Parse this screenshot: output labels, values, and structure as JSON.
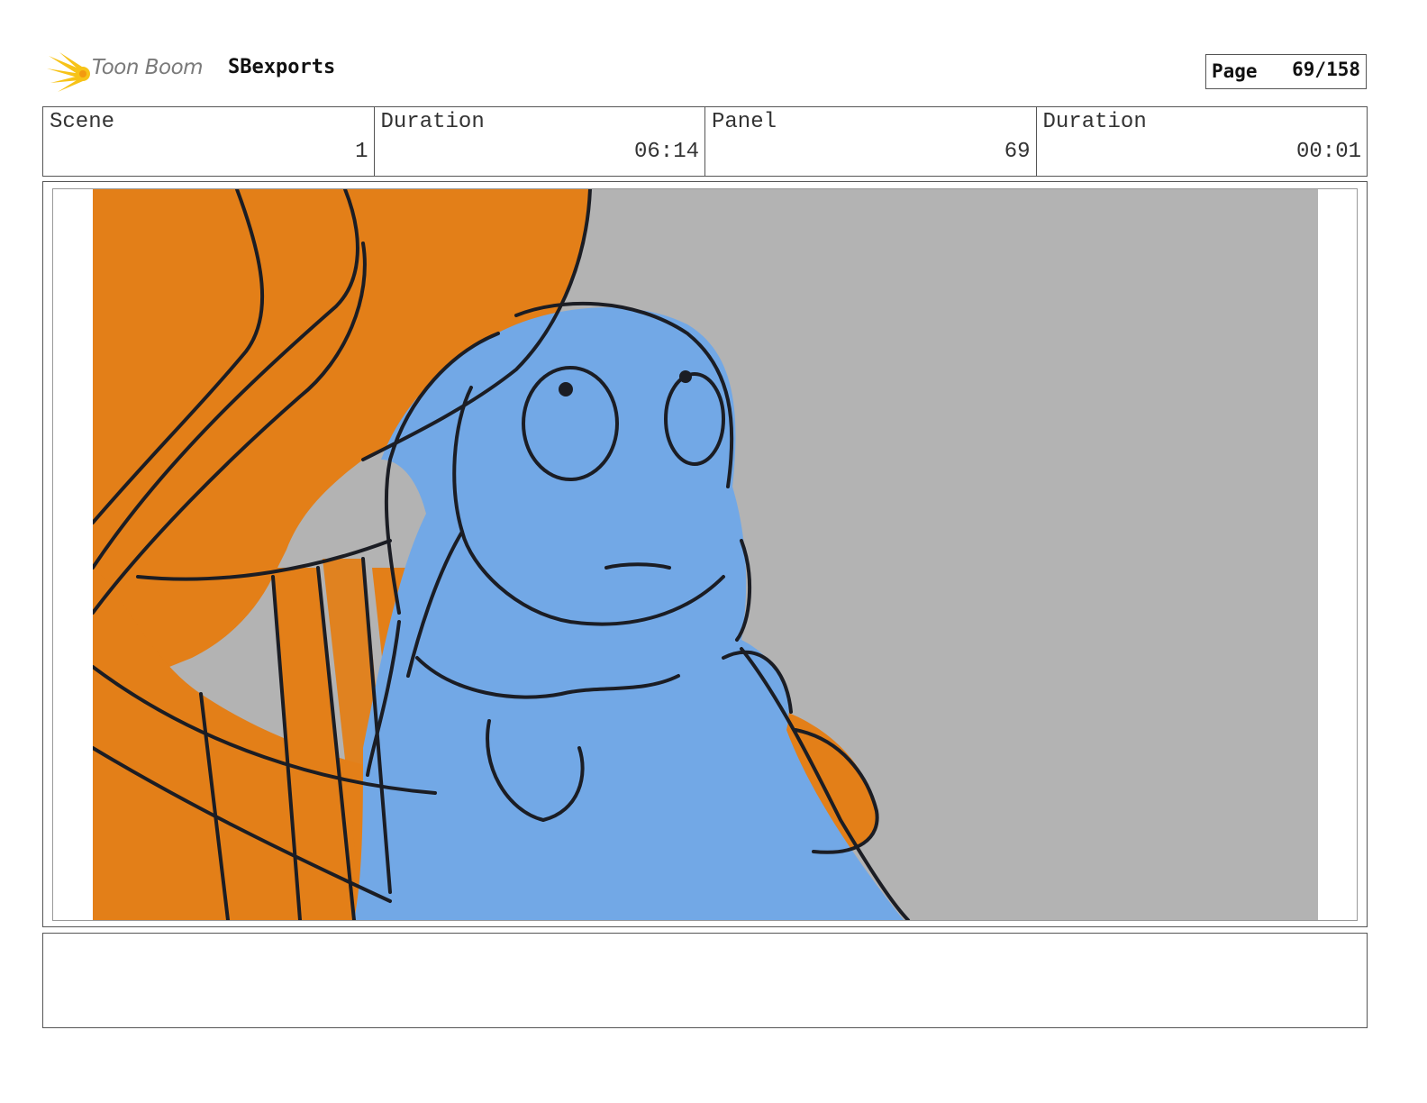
{
  "header": {
    "brand": "Toon Boom",
    "project": "SBexports",
    "page_label": "Page",
    "page_value": "69/158"
  },
  "info": {
    "scene_label": "Scene",
    "scene_value": "1",
    "scene_duration_label": "Duration",
    "scene_duration_value": "06:14",
    "panel_label": "Panel",
    "panel_value": "69",
    "panel_duration_label": "Duration",
    "panel_duration_value": "00:01"
  },
  "colors": {
    "background_gray": "#b3b3b3",
    "orange": "#e37f18",
    "blue": "#72a8e6",
    "ink": "#1b1d24",
    "logo_yellow": "#f7c318"
  },
  "notes": {
    "text": ""
  }
}
